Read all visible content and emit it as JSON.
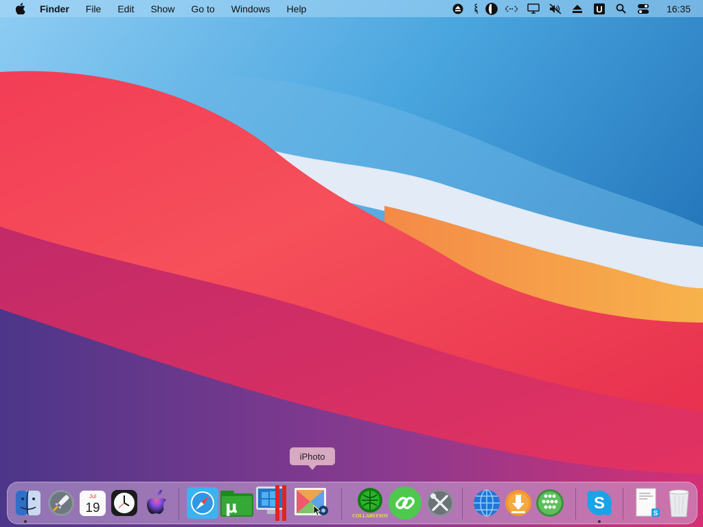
{
  "menubar": {
    "apple_icon": "apple-logo-icon",
    "app_name": "Finder",
    "items": [
      "File",
      "Edit",
      "Show",
      "Go to",
      "Windows",
      "Help"
    ],
    "status_icons": [
      "eject-circle-icon",
      "keyboard-layout-icon",
      "dark-mode-toggle-icon",
      "code-brackets-icon",
      "display-icon",
      "sound-muted-icon",
      "eject-icon",
      "ublock-icon",
      "search-icon",
      "control-center-icon"
    ],
    "clock": "16:35"
  },
  "dock": {
    "tooltip": "iPhoto",
    "calendar": {
      "month": "Jul",
      "day": "19"
    },
    "collabsysos_label": "COLLABSYSOS",
    "apps": [
      "finder",
      "launchpad",
      "calendar",
      "clock",
      "apple-music",
      "safari",
      "utorrent",
      "parallels-desktop",
      "iphoto",
      "collabsysos",
      "link-app",
      "system-utilities",
      "network-globe",
      "downloader",
      "community",
      "skype",
      "document-stack",
      "trash"
    ]
  },
  "colors": {
    "sky_blue": "#3f9cdc",
    "wave_red": "#f2355a",
    "wave_orange": "#f6a23c",
    "wave_white": "#dce6f4",
    "bottom_purple": "#5a3a8a"
  }
}
